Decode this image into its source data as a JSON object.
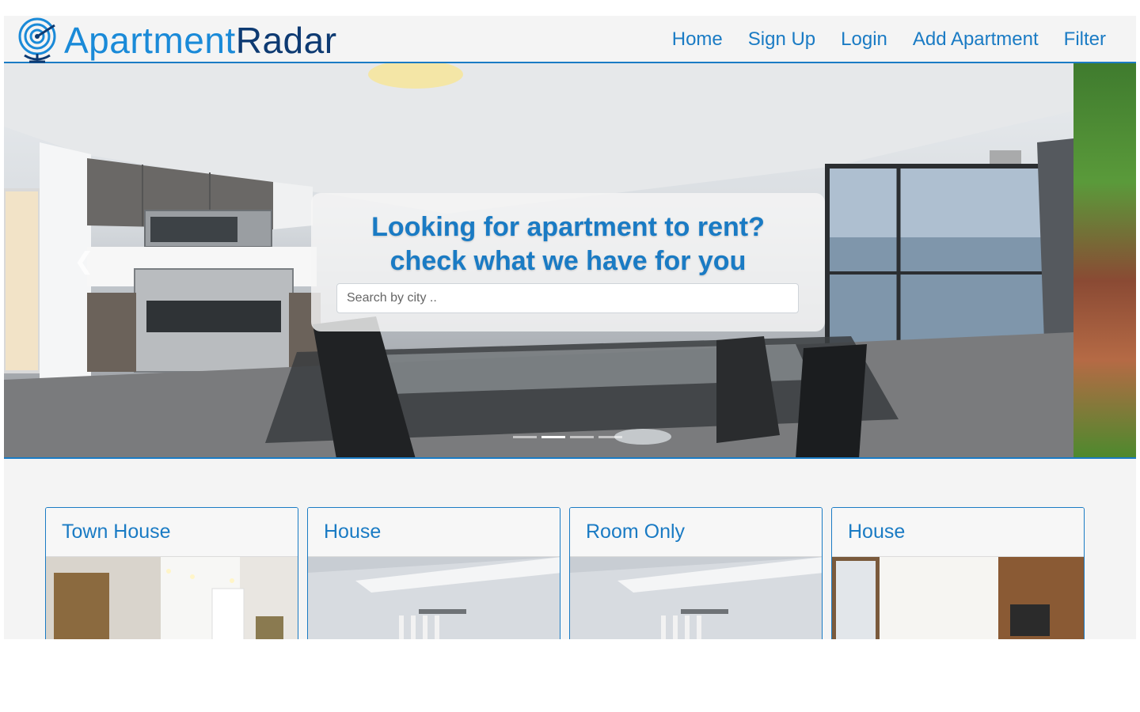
{
  "brand": {
    "name_part1": "Apartment",
    "name_part2": "Radar"
  },
  "nav": {
    "items": [
      {
        "label": "Home"
      },
      {
        "label": "Sign Up"
      },
      {
        "label": "Login"
      },
      {
        "label": "Add Apartment"
      },
      {
        "label": "Filter"
      }
    ]
  },
  "hero": {
    "title_line1": "Looking for apartment to rent?",
    "title_line2": "check what we have for you",
    "search": {
      "placeholder": "Search by city ..",
      "value": ""
    },
    "slide_count": 4,
    "active_slide": 2
  },
  "listings": [
    {
      "title": "Town House"
    },
    {
      "title": "House"
    },
    {
      "title": "Room Only"
    },
    {
      "title": "House"
    }
  ],
  "colors": {
    "accent": "#1a7bc4",
    "brand_light": "#1a8ad8",
    "brand_dark": "#0d3a72",
    "page_background": "#f4f4f4"
  },
  "icons": {
    "logo": "radar-globe-icon",
    "prev": "chevron-left-icon"
  }
}
